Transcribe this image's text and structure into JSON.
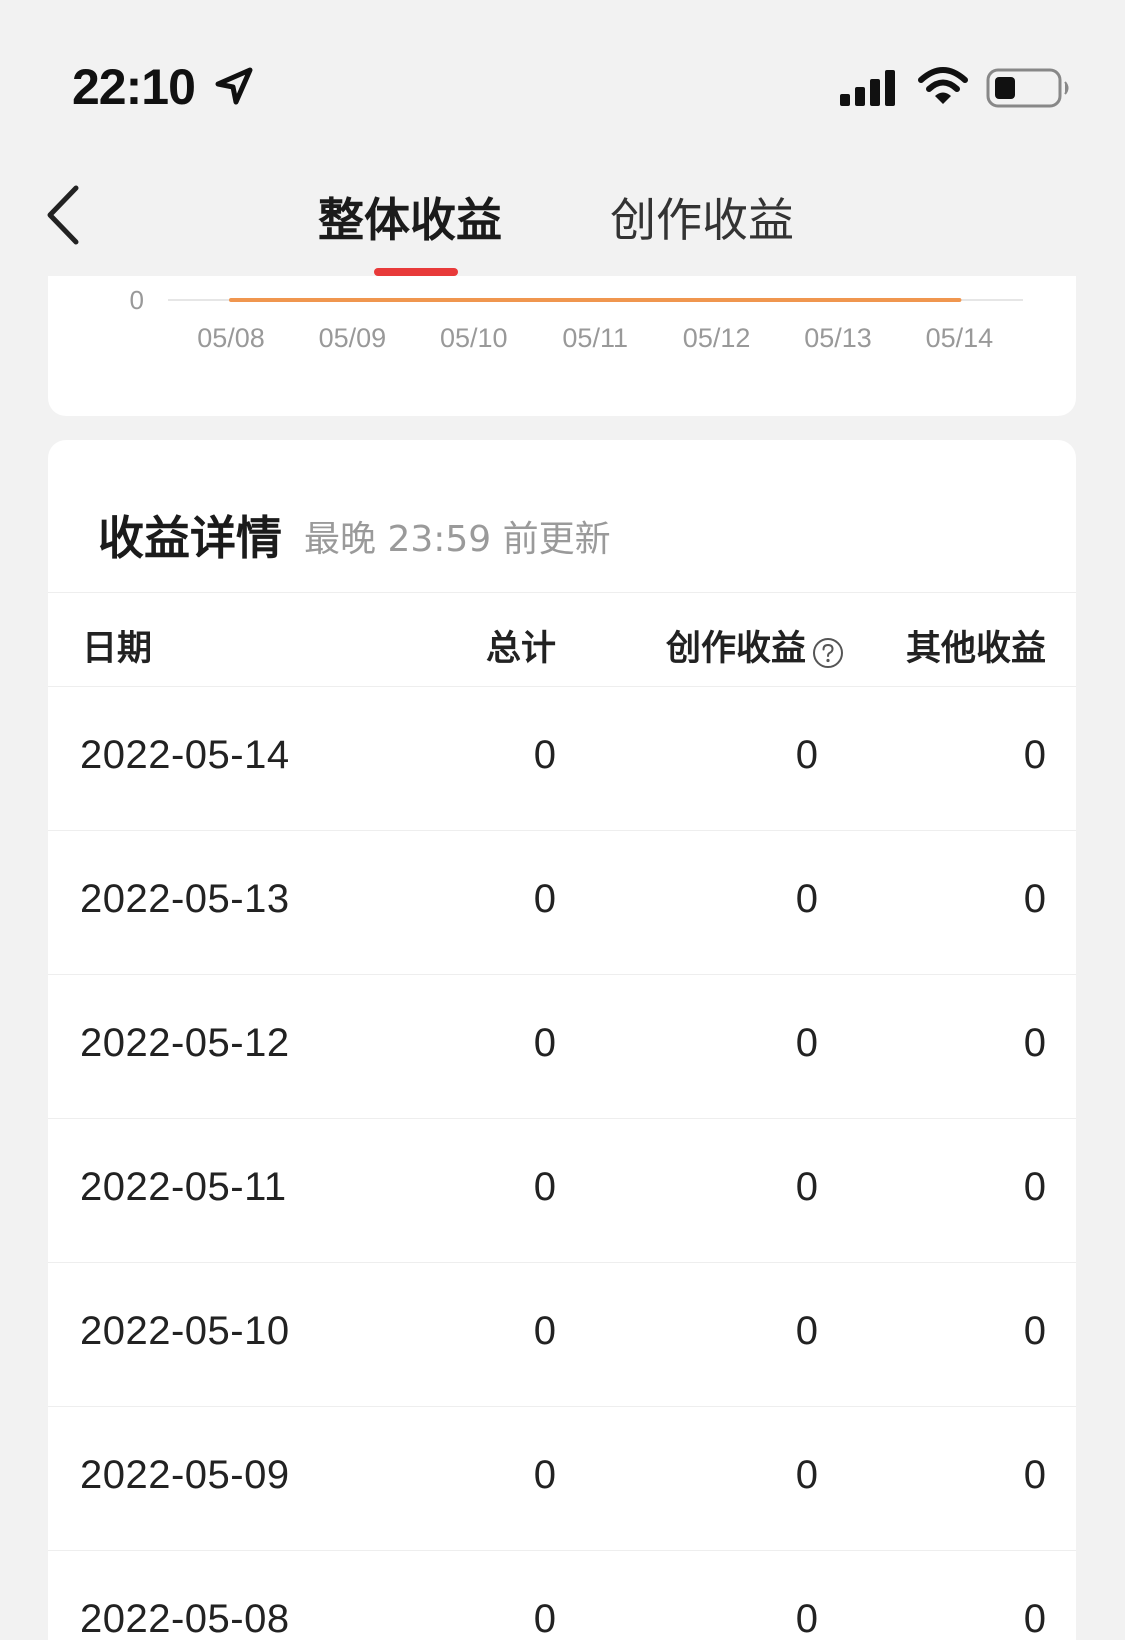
{
  "status_bar": {
    "time": "22:10"
  },
  "nav": {
    "tabs": [
      {
        "label": "整体收益",
        "active": true
      },
      {
        "label": "创作收益",
        "active": false
      }
    ]
  },
  "chart_data": {
    "type": "line",
    "x": [
      "05/08",
      "05/09",
      "05/10",
      "05/11",
      "05/12",
      "05/13",
      "05/14"
    ],
    "series": [
      {
        "values": [
          0,
          0,
          0,
          0,
          0,
          0,
          0
        ],
        "color": "#f0964f"
      }
    ],
    "y_ticks": [
      "0"
    ],
    "grid": true
  },
  "details": {
    "title": "收益详情",
    "subtitle": "最晚 23:59 前更新",
    "columns": {
      "date": "日期",
      "total": "总计",
      "creation": "创作收益",
      "other": "其他收益"
    },
    "rows": [
      {
        "date": "2022-05-14",
        "total": "0",
        "creation": "0",
        "other": "0"
      },
      {
        "date": "2022-05-13",
        "total": "0",
        "creation": "0",
        "other": "0"
      },
      {
        "date": "2022-05-12",
        "total": "0",
        "creation": "0",
        "other": "0"
      },
      {
        "date": "2022-05-11",
        "total": "0",
        "creation": "0",
        "other": "0"
      },
      {
        "date": "2022-05-10",
        "total": "0",
        "creation": "0",
        "other": "0"
      },
      {
        "date": "2022-05-09",
        "total": "0",
        "creation": "0",
        "other": "0"
      },
      {
        "date": "2022-05-08",
        "total": "0",
        "creation": "0",
        "other": "0"
      }
    ]
  },
  "colors": {
    "accent": "#e83a3a",
    "chart_line": "#f0964f",
    "background": "#f2f2f2"
  }
}
